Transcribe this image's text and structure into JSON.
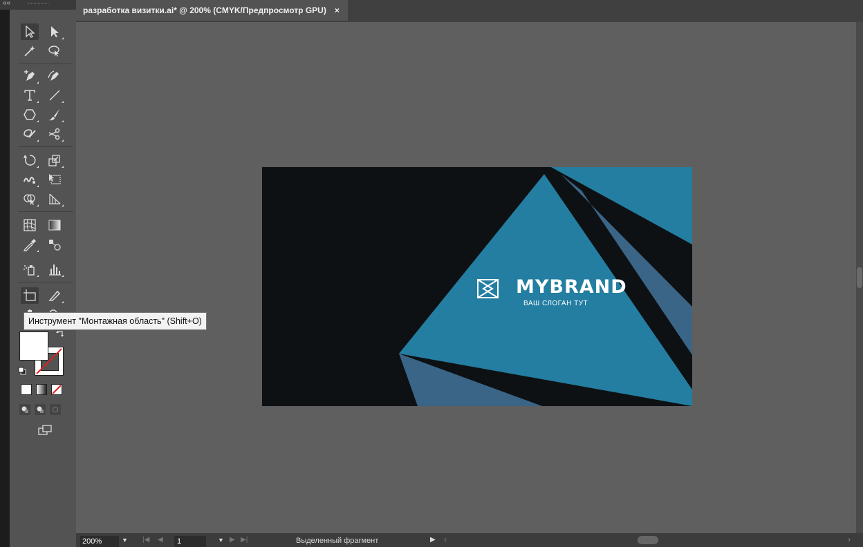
{
  "document_tab": {
    "title": "разработка визитки.ai* @ 200% (CMYK/Предпросмотр GPU)",
    "close_label": "×"
  },
  "toolbar": {
    "collapse_label": "««",
    "tooltip": "Инструмент \"Монтажная область\" (Shift+O)"
  },
  "artboard": {
    "logo_text": "MYBRAND",
    "slogan": "ВАШ СЛОГАН ТУТ",
    "colors": {
      "background": "#0e1114",
      "primary": "#247ea1",
      "shade": "#3a6587"
    }
  },
  "statusbar": {
    "zoom": "200%",
    "page": "1",
    "status": "Выделенный фрагмент"
  }
}
